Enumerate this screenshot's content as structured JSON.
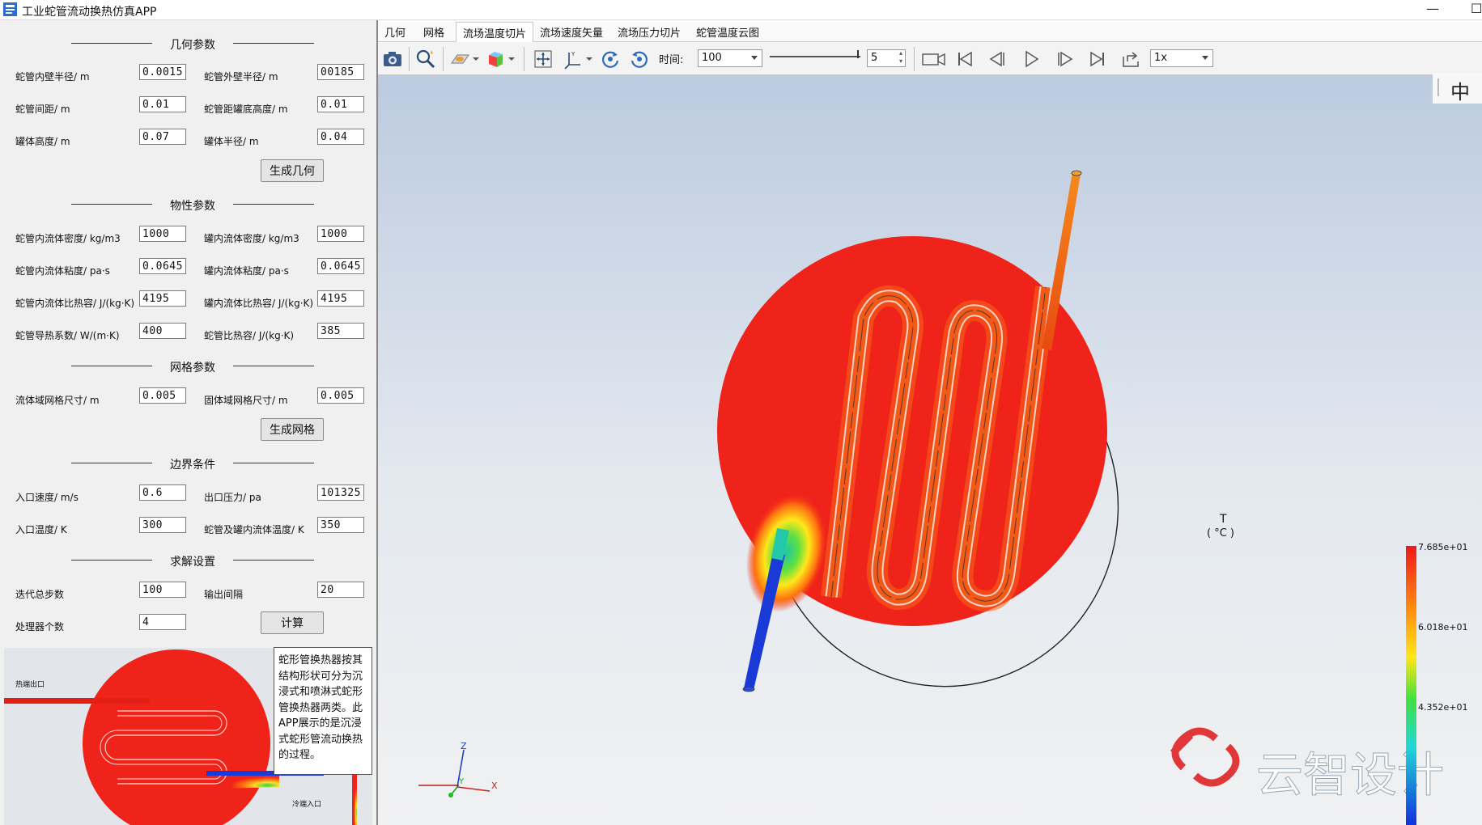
{
  "window": {
    "title": "工业蛇管流动换热仿真APP"
  },
  "sections": {
    "geometry": "几何参数",
    "material": "物性参数",
    "mesh": "网格参数",
    "boundary": "边界条件",
    "solver": "求解设置"
  },
  "fields": {
    "coil_inner_r": {
      "label": "蛇管内壁半径/ m",
      "value": "0.0015"
    },
    "coil_outer_r": {
      "label": "蛇管外壁半径/ m",
      "value": "00185"
    },
    "coil_spacing": {
      "label": "蛇管间距/ m",
      "value": "0.01"
    },
    "coil_bottom": {
      "label": "蛇管距罐底高度/ m",
      "value": "0.01"
    },
    "tank_height": {
      "label": "罐体高度/ m",
      "value": "0.07"
    },
    "tank_radius": {
      "label": "罐体半径/ m",
      "value": "0.04"
    },
    "in_density": {
      "label": "蛇管内流体密度/ kg/m3",
      "value": "1000"
    },
    "tank_density": {
      "label": "罐内流体密度/ kg/m3",
      "value": "1000"
    },
    "in_visc": {
      "label": "蛇管内流体粘度/ pa·s",
      "value": "0.0645"
    },
    "tank_visc": {
      "label": "罐内流体粘度/ pa·s",
      "value": "0.0645"
    },
    "in_cp": {
      "label": "蛇管内流体比热容/ J/(kg·K)",
      "value": "4195"
    },
    "tank_cp": {
      "label": "罐内流体比热容/ J/(kg·K)",
      "value": "4195"
    },
    "coil_k": {
      "label": "蛇管导热系数/ W/(m·K)",
      "value": "400"
    },
    "coil_cp": {
      "label": "蛇管比热容/ J/(kg·K)",
      "value": "385"
    },
    "fluid_mesh": {
      "label": "流体域网格尺寸/ m",
      "value": "0.005"
    },
    "solid_mesh": {
      "label": "固体域网格尺寸/ m",
      "value": "0.005"
    },
    "inlet_vel": {
      "label": "入口速度/ m/s",
      "value": "0.6"
    },
    "outlet_p": {
      "label": "出口压力/ pa",
      "value": "101325"
    },
    "inlet_T": {
      "label": "入口温度/ K",
      "value": "300"
    },
    "tank_T": {
      "label": "蛇管及罐内流体温度/ K",
      "value": "350"
    },
    "iterations": {
      "label": "迭代总步数",
      "value": "100"
    },
    "out_interval": {
      "label": "输出间隔",
      "value": "20"
    },
    "cpus": {
      "label": "处理器个数",
      "value": "4"
    }
  },
  "buttons": {
    "gen_geom": "生成几何",
    "gen_mesh": "生成网格",
    "compute": "计算"
  },
  "thumbnail": {
    "hot_outlet": "热端出口",
    "cold_inlet": "冷端入口"
  },
  "note": "蛇形管换热器按其结构形状可分为沉浸式和喷淋式蛇形管换热器两类。此APP展示的是沉浸式蛇形管流动换热的过程。",
  "tabs": [
    "几何",
    "网格",
    "流场温度切片",
    "流场速度矢量",
    "流场压力切片",
    "蛇管温度云图"
  ],
  "active_tab": "流场温度切片",
  "toolbar": {
    "time_label": "时间:",
    "time_value": "100",
    "step_value": "5",
    "speed_value": "1x"
  },
  "ime": "中",
  "legend": {
    "title": "T",
    "unit": "( °C )",
    "max": "7.685e+01",
    "mid": "6.018e+01",
    "low": "4.352e+01"
  },
  "axes": {
    "z": "Z",
    "y": "Y",
    "x": "X"
  },
  "watermark": "云智设计",
  "colors": {
    "hot": "#f0231a",
    "cold": "#1a3ad8",
    "accent": "#1d6fd6"
  }
}
